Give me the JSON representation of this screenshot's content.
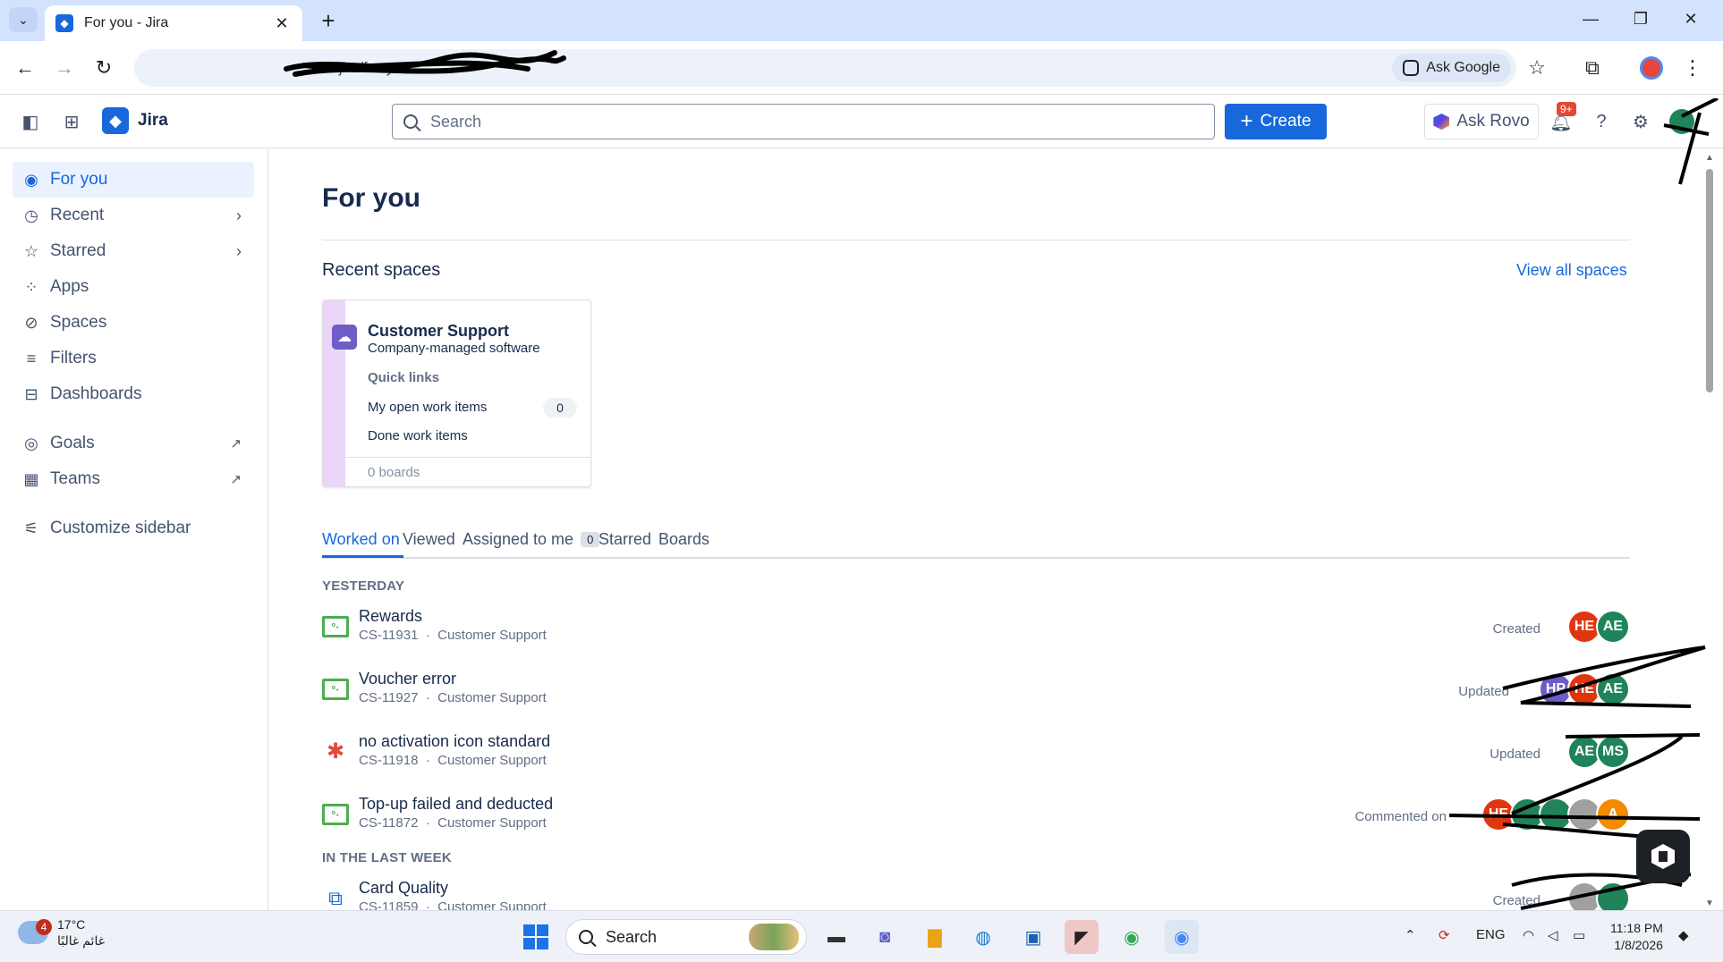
{
  "browser": {
    "tab_title": "For you - Jira",
    "url": "/jira/for-you",
    "ask_google": "Ask Google",
    "new_tab_symbol": "+",
    "icons": [
      "tab-search-icon",
      "close-icon",
      "back-icon",
      "forward-icon",
      "reload-icon",
      "star-icon",
      "extensions-icon",
      "profile-icon",
      "menu-icon",
      "minimize-icon",
      "restore-icon",
      "close-window-icon"
    ]
  },
  "topnav": {
    "app_name": "Jira",
    "search_placeholder": "Search",
    "create_label": "Create",
    "ask_rovo_label": "Ask Rovo",
    "notification_count": "9+"
  },
  "sidebar": {
    "items": [
      {
        "label": "For you",
        "icon": "person-icon",
        "active": true
      },
      {
        "label": "Recent",
        "icon": "clock-icon",
        "chevron": true
      },
      {
        "label": "Starred",
        "icon": "star-icon",
        "chevron": true
      },
      {
        "label": "Apps",
        "icon": "apps-icon"
      },
      {
        "label": "Spaces",
        "icon": "spaces-icon"
      },
      {
        "label": "Filters",
        "icon": "filter-icon"
      },
      {
        "label": "Dashboards",
        "icon": "dashboard-icon"
      },
      {
        "label": "Goals",
        "icon": "goals-icon",
        "external": true
      },
      {
        "label": "Teams",
        "icon": "teams-icon",
        "external": true
      },
      {
        "label": "Customize sidebar",
        "icon": "customize-icon"
      }
    ]
  },
  "main": {
    "title": "For you",
    "recent_spaces_title": "Recent spaces",
    "view_all_label": "View all spaces",
    "space_card": {
      "name": "Customer Support",
      "type": "Company-managed software",
      "quick_links_label": "Quick links",
      "link_open": "My open work items",
      "open_count": "0",
      "link_done": "Done work items",
      "boards": "0 boards"
    },
    "tabs": [
      {
        "label": "Worked on",
        "active": true
      },
      {
        "label": "Viewed"
      },
      {
        "label": "Assigned to me",
        "count": "0"
      },
      {
        "label": "Starred"
      },
      {
        "label": "Boards"
      }
    ],
    "groups": [
      {
        "header": "YESTERDAY",
        "items": [
          {
            "title": "Rewards",
            "key": "CS-11931",
            "space": "Customer Support",
            "type": "story",
            "action": "Created",
            "avatars": [
              {
                "initials": "HE",
                "color": "#e0360f"
              },
              {
                "initials": "AE",
                "color": "#1f845a"
              }
            ]
          },
          {
            "title": "Voucher error",
            "key": "CS-11927",
            "space": "Customer Support",
            "type": "story",
            "action": "Updated",
            "avatars": [
              {
                "initials": "HP",
                "color": "#6e5dc6"
              },
              {
                "initials": "HE",
                "color": "#e0360f"
              },
              {
                "initials": "AE",
                "color": "#1f845a"
              }
            ]
          },
          {
            "title": "no activation icon standard",
            "key": "CS-11918",
            "space": "Customer Support",
            "type": "bug",
            "action": "Updated",
            "avatars": [
              {
                "initials": "AE",
                "color": "#1f845a"
              },
              {
                "initials": "MS",
                "color": "#1f845a"
              }
            ]
          },
          {
            "title": "Top-up failed and deducted",
            "key": "CS-11872",
            "space": "Customer Support",
            "type": "story",
            "action": "Commented on",
            "avatars": [
              {
                "initials": "HE",
                "color": "#e0360f"
              },
              {
                "initials": "",
                "color": "#1f845a"
              },
              {
                "initials": "",
                "color": "#1f845a"
              },
              {
                "initials": "",
                "color": "#a0a0a0"
              },
              {
                "initials": "A",
                "color": "#f38a00"
              }
            ]
          }
        ]
      },
      {
        "header": "IN THE LAST WEEK",
        "items": [
          {
            "title": "Card Quality",
            "key": "CS-11859",
            "space": "Customer Support",
            "type": "subtask",
            "action": "Created",
            "avatars": [
              {
                "initials": "",
                "color": "#a0a0a0"
              },
              {
                "initials": "",
                "color": "#1f845a"
              }
            ]
          }
        ]
      }
    ]
  },
  "taskbar": {
    "weather_temp": "17°C",
    "weather_desc": "غائم غالبًا",
    "weather_badge": "4",
    "search_label": "Search",
    "lang": "ENG",
    "time": "11:18 PM",
    "date": "1/8/2026"
  }
}
